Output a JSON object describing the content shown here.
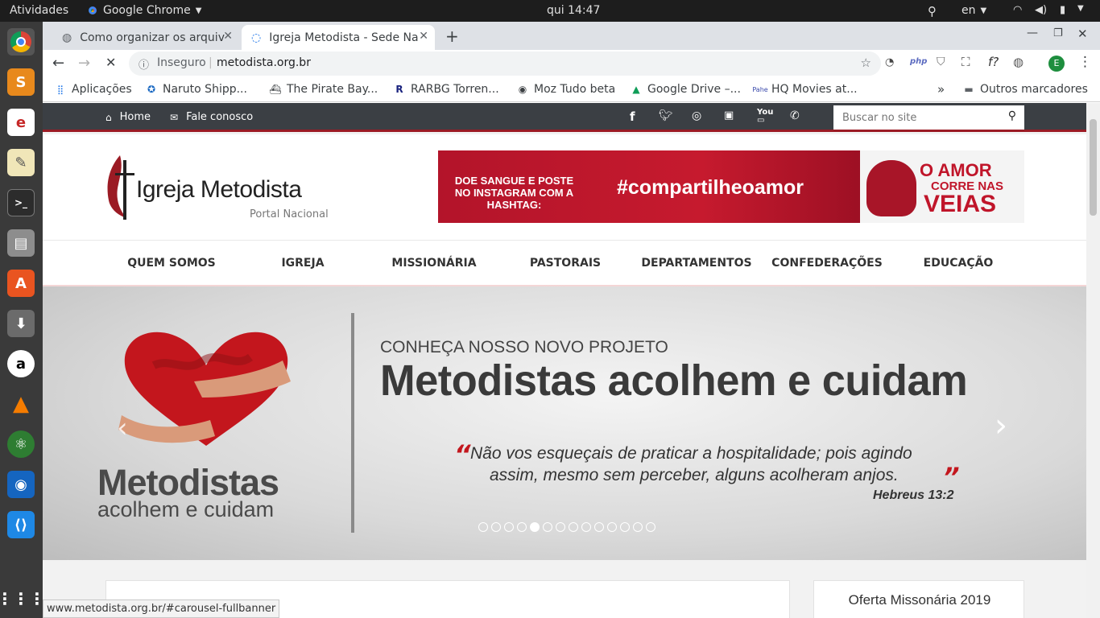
{
  "system": {
    "activities": "Atividades",
    "app_name": "Google Chrome",
    "clock": "qui 14:47",
    "lang": "en"
  },
  "tabs": [
    {
      "label": "Como organizar os arquiv",
      "active": false
    },
    {
      "label": "Igreja Metodista - Sede Na",
      "active": true
    }
  ],
  "toolbar": {
    "security_label": "Inseguro",
    "url": "metodista.org.br",
    "profile_initial": "E"
  },
  "bookmarks": [
    {
      "label": "Aplicações"
    },
    {
      "label": "Naruto Shipp..."
    },
    {
      "label": "The Pirate Bay..."
    },
    {
      "label": "RARBG Torren..."
    },
    {
      "label": "Moz Tudo beta"
    },
    {
      "label": "Google Drive –..."
    },
    {
      "label": "HQ Movies at..."
    }
  ],
  "bookmarks_more": "»",
  "bookmarks_other": "Outros marcadores",
  "site": {
    "topnav": {
      "home": "Home",
      "contact": "Fale conosco"
    },
    "search_placeholder": "Buscar no site",
    "logo": {
      "name": "Igreja Metodista",
      "subtitle": "Portal Nacional"
    },
    "ad": {
      "left_text": "DOE SANGUE E POSTE NO INSTAGRAM COM A HASHTAG:",
      "hashtag": "#compartilheoamor",
      "right_line1": "O AMOR",
      "right_line2": "CORRE NAS",
      "right_line3": "VEIAS"
    },
    "nav": [
      "QUEM SOMOS",
      "IGREJA",
      "MISSIONÁRIA",
      "PASTORAIS",
      "DEPARTAMENTOS",
      "CONFEDERAÇÕES",
      "EDUCAÇÃO"
    ],
    "banner": {
      "logo_line1": "Metodistas",
      "logo_line2": "acolhem e cuidam",
      "kicker": "CONHEÇA NOSSO NOVO PROJETO",
      "title": "Metodistas acolhem e cuidam",
      "quote_line1": "Não vos esqueçais de praticar a hospitalidade; pois agindo",
      "quote_line2": "assim, mesmo sem perceber, alguns acolheram anjos.",
      "quote_open": "“",
      "quote_close": "”",
      "reference": "Hebreus 13:2",
      "slides_total": 14,
      "active_slide": 5
    },
    "sidebar_title": "Oferta Missonária 2019"
  },
  "status_url": "www.metodista.org.br/#carousel-fullbanner",
  "colors": {
    "brand_red": "#9b1b24",
    "sitebar": "#3b3f44"
  }
}
